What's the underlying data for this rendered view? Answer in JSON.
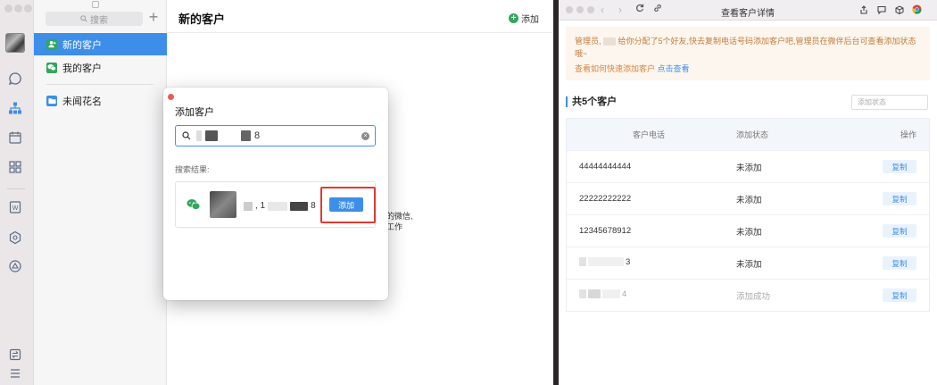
{
  "left_window": {
    "search": {
      "placeholder": "搜索"
    },
    "nav": [
      {
        "label": "新的客户",
        "icon": "user-add-icon",
        "active": true
      },
      {
        "label": "我的客户",
        "icon": "wechat-icon",
        "active": false
      },
      {
        "label": "未闻花名",
        "icon": "folder-icon",
        "active": false
      }
    ],
    "main": {
      "title": "新的客户",
      "add_label": "添加",
      "hint_lines": [
        "的微信,",
        "工作"
      ]
    },
    "colors": {
      "accent": "#3d8ee8",
      "green": "#31a75b",
      "highlight": "#e03b30"
    }
  },
  "dialog": {
    "title": "添加客户",
    "search_value_suffix": "8",
    "results_label": "搜索结果:",
    "result": {
      "name_parts": [
        ", 1",
        "8"
      ]
    },
    "add_button_label": "添加"
  },
  "right_window": {
    "window_title": "查看客户详情",
    "notice": {
      "prefix": "管理员,",
      "message": "给你分配了5个好友,快去复制电话号码添加客户吧,管理员在微伴后台可查看添加状态哦~",
      "link_text": "查看如何快速添加客户",
      "link_action": "点击查看"
    },
    "count_title": "共5个客户",
    "status_filter_placeholder": "添加状态",
    "table": {
      "headers": [
        "客户电话",
        "添加状态",
        "操作"
      ],
      "rows": [
        {
          "phone": "44444444444",
          "status": "未添加",
          "action": "复制",
          "masked": false,
          "muted": false
        },
        {
          "phone": "22222222222",
          "status": "未添加",
          "action": "复制",
          "masked": false,
          "muted": false
        },
        {
          "phone": "12345678912",
          "status": "未添加",
          "action": "复制",
          "masked": false,
          "muted": false
        },
        {
          "phone": "3",
          "status": "未添加",
          "action": "复制",
          "masked": true,
          "muted": false
        },
        {
          "phone": "4",
          "status": "添加成功",
          "action": "复制",
          "masked": true,
          "muted": true
        }
      ]
    }
  }
}
